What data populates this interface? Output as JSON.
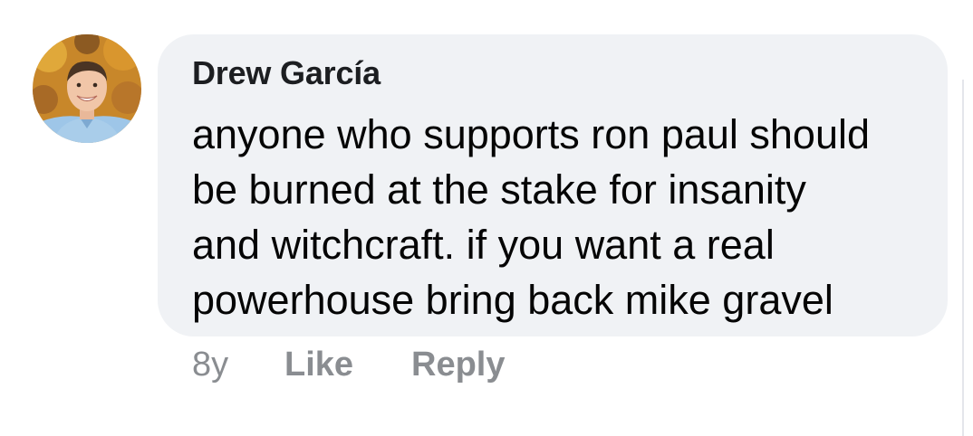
{
  "comment": {
    "author": "Drew García",
    "text_lines": [
      "anyone who supports ron paul should",
      "be burned at the stake for insanity",
      "and witchcraft. if you want a real",
      "powerhouse bring back mike gravel"
    ]
  },
  "actions": {
    "time": "8y",
    "like_label": "Like",
    "reply_label": "Reply"
  },
  "colors": {
    "bubble": "#f0f2f5",
    "author": "#1c1e21",
    "text": "#050505",
    "action": "#8a8d91"
  },
  "icons": {
    "avatar": "profile-photo"
  }
}
